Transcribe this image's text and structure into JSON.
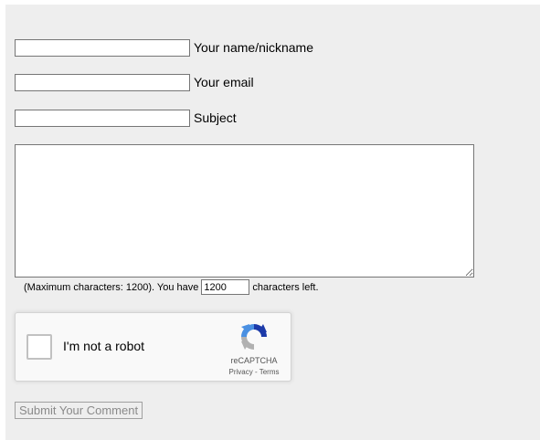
{
  "form": {
    "name_label": "Your name/nickname",
    "name_value": "",
    "email_label": "Your email",
    "email_value": "",
    "subject_label": "Subject",
    "subject_value": "",
    "comment_value": "",
    "counter": {
      "prefix": "(Maximum characters: 1200). You have",
      "remaining": "1200",
      "suffix": "characters left."
    },
    "submit_label": "Submit Your Comment",
    "submit_disabled": true
  },
  "recaptcha": {
    "label": "I'm not a robot",
    "brand": "reCAPTCHA",
    "privacy": "Privacy",
    "separator": " - ",
    "terms": "Terms",
    "checked": false
  },
  "colors": {
    "panel_background": "#eeeeee",
    "recaptcha_blue": "#4a90e2",
    "recaptcha_darkblue": "#1c3aa9",
    "recaptcha_gray": "#b1b1b1"
  }
}
